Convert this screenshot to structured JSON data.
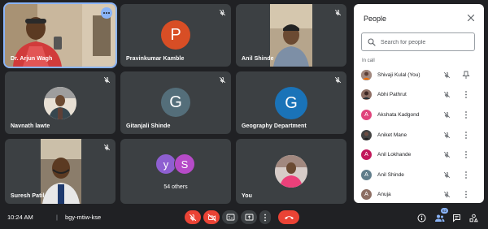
{
  "tiles": [
    {
      "name": "Dr. Arjun Wagh"
    },
    {
      "name": "Pravinkumar Kamble",
      "initial": "P",
      "color": "#d84e25"
    },
    {
      "name": "Anil Shinde"
    },
    {
      "name": "Navnath lawte"
    },
    {
      "name": "Gitanjali Shinde",
      "initial": "G",
      "color": "#546e7a"
    },
    {
      "name": "Geography Department",
      "initial": "G",
      "color": "#1a73b8"
    },
    {
      "name": "Suresh Patil"
    },
    {
      "others_label": "54 others",
      "initial_a": "y",
      "color_a": "#8e5fd1",
      "initial_b": "S",
      "color_b": "#b64bc8"
    },
    {
      "name": "You"
    }
  ],
  "panel": {
    "title": "People",
    "search_placeholder": "Search for people",
    "section_label": "In call",
    "people": [
      {
        "name": "Shivaji Kulal (You)",
        "initial": "",
        "color": "#7b5e3c",
        "action": "pin-icon"
      },
      {
        "name": "Abhi Pathrut",
        "initial": "",
        "color": "#5a4a3a",
        "action": "more-vert-icon"
      },
      {
        "name": "Akshata Kadgond",
        "initial": "A",
        "color": "#e0447c",
        "action": "more-vert-icon"
      },
      {
        "name": "Aniket Mane",
        "initial": "",
        "color": "#3b3b3b",
        "action": "more-vert-icon"
      },
      {
        "name": "Anil Lokhande",
        "initial": "A",
        "color": "#c2185b",
        "action": "more-vert-icon"
      },
      {
        "name": "Anil Shinde",
        "initial": "A",
        "color": "#607d8b",
        "action": "more-vert-icon"
      },
      {
        "name": "Anuja",
        "initial": "A",
        "color": "#8d6e63",
        "action": "more-vert-icon"
      }
    ]
  },
  "bottom": {
    "time": "10:24 AM",
    "separator": "|",
    "meeting_code": "bgy-mtiw-kse",
    "participants_count": "62"
  },
  "colors": {
    "accent": "#8ab4f8",
    "danger": "#ea4335",
    "tile": "#3c4043",
    "background": "#202124"
  }
}
